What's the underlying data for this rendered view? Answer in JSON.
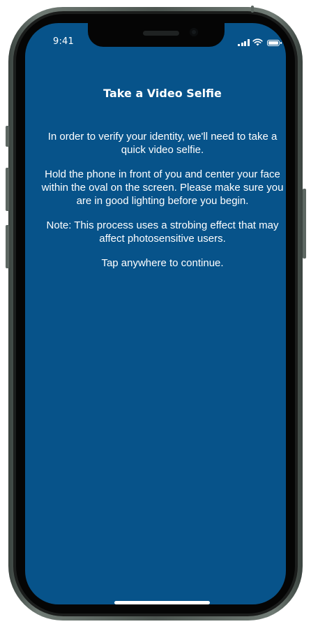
{
  "status_bar": {
    "time": "9:41",
    "signal_icon": "cellular-signal-icon",
    "wifi_icon": "wifi-icon",
    "battery_icon": "battery-icon"
  },
  "screen": {
    "background_color": "#07538a",
    "title": "Take a Video Selfie",
    "paragraphs": [
      "In order to verify your identity, we'll need to take a quick video selfie.",
      "Hold the phone in front of you and center your face within the oval on the screen.  Please make sure you are in good lighting before you begin.",
      "Note: This process uses a strobing effect that may affect photosensitive users."
    ],
    "tap_prompt": "Tap anywhere to continue."
  }
}
